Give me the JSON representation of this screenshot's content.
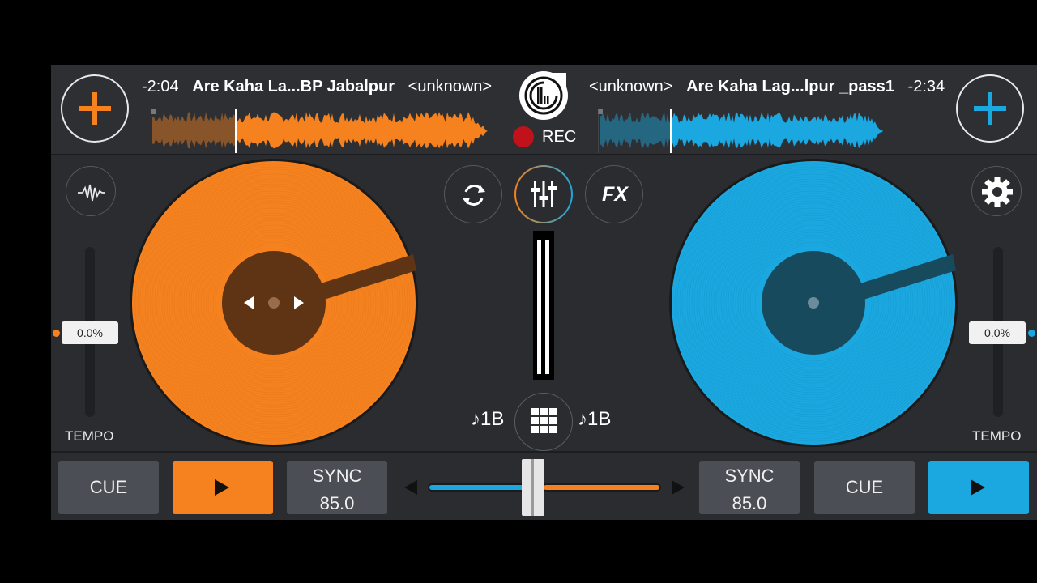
{
  "deck_left": {
    "time": "-2:04",
    "title": "Are Kaha La...BP Jabalpur",
    "artist": "<unknown>",
    "tempo_value": "0.0%",
    "tempo_label": "TEMPO",
    "bpm": "♪1B",
    "cue_label": "CUE",
    "sync_label": "SYNC",
    "sync_value": "85.0",
    "color": "#f5821f"
  },
  "deck_right": {
    "time": "-2:34",
    "title": "Are Kaha Lag...lpur _pass1",
    "artist": "<unknown>",
    "tempo_value": "0.0%",
    "tempo_label": "TEMPO",
    "bpm": "♪1B",
    "cue_label": "CUE",
    "sync_label": "SYNC",
    "sync_value": "85.0",
    "color": "#1ba8e0"
  },
  "center": {
    "rec_label": "REC",
    "fx_label": "FX"
  },
  "icons": [
    "plus-icon",
    "waveform-icon",
    "loop-icon",
    "mixer-icon",
    "fx-icon",
    "gear-icon",
    "grid-icon",
    "play-icon",
    "prev-icon",
    "next-icon",
    "app-logo-icon",
    "record-icon"
  ]
}
